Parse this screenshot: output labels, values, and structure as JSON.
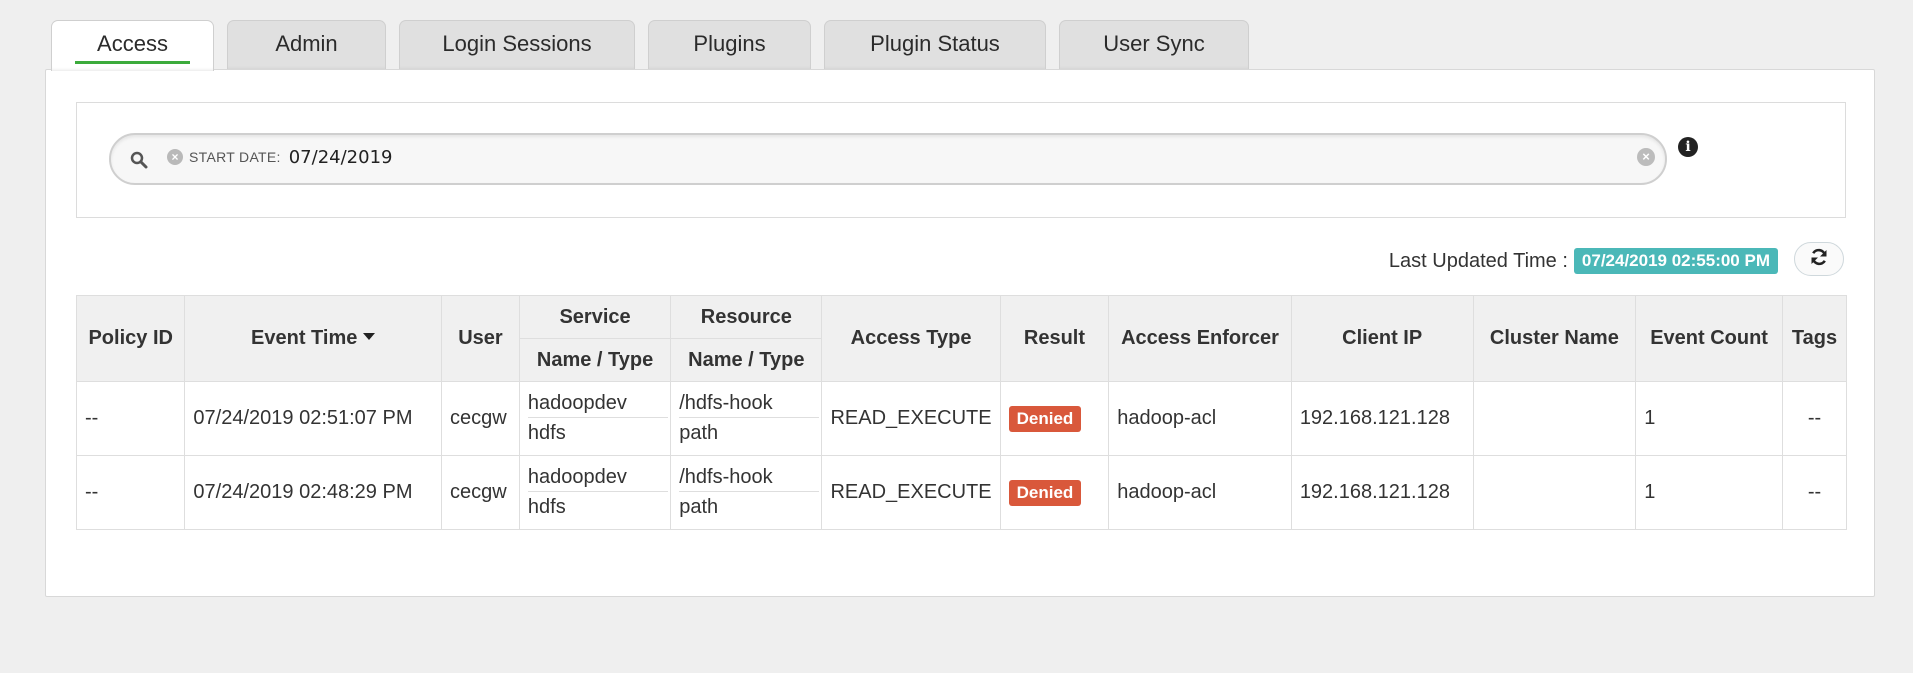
{
  "tabs": [
    {
      "label": "Access",
      "active": true
    },
    {
      "label": "Admin"
    },
    {
      "label": "Login Sessions"
    },
    {
      "label": "Plugins"
    },
    {
      "label": "Plugin Status"
    },
    {
      "label": "User Sync"
    }
  ],
  "search": {
    "facet_label": "START DATE:",
    "facet_value": "07/24/2019",
    "close_glyph": "×",
    "clear_glyph": "×",
    "info_glyph": "i"
  },
  "last_updated": {
    "label": "Last Updated Time :",
    "time": "07/24/2019 02:55:00 PM"
  },
  "table": {
    "headers": {
      "policy_id": "Policy ID",
      "event_time": "Event Time",
      "user": "User",
      "service_group": "Service",
      "resource_group": "Resource",
      "service_sub": "Name / Type",
      "resource_sub": "Name / Type",
      "access_type": "Access Type",
      "result": "Result",
      "access_enforcer": "Access Enforcer",
      "client_ip": "Client IP",
      "cluster_name": "Cluster Name",
      "event_count": "Event Count",
      "tags": "Tags"
    },
    "rows": [
      {
        "policy_id": "--",
        "event_time": "07/24/2019 02:51:07 PM",
        "user": "cecgw",
        "service_name": "hadoopdev",
        "service_type": "hdfs",
        "resource_name": "/hdfs-hook",
        "resource_type": "path",
        "access_type": "READ_EXECUTE",
        "result": "Denied",
        "access_enforcer": "hadoop-acl",
        "client_ip": "192.168.121.128",
        "cluster_name": "",
        "event_count": "1",
        "tags": "--"
      },
      {
        "policy_id": "--",
        "event_time": "07/24/2019 02:48:29 PM",
        "user": "cecgw",
        "service_name": "hadoopdev",
        "service_type": "hdfs",
        "resource_name": "/hdfs-hook",
        "resource_type": "path",
        "access_type": "READ_EXECUTE",
        "result": "Denied",
        "access_enforcer": "hadoop-acl",
        "client_ip": "192.168.121.128",
        "cluster_name": "",
        "event_count": "1",
        "tags": "--"
      }
    ]
  },
  "colors": {
    "active_tab_underline": "#3cab3c",
    "last_updated_badge": "#4bb8b8",
    "denied_badge": "#d9583b"
  },
  "icons": {
    "search": "search-icon",
    "refresh": "refresh-icon",
    "info": "info-icon",
    "clear": "clear-icon"
  }
}
